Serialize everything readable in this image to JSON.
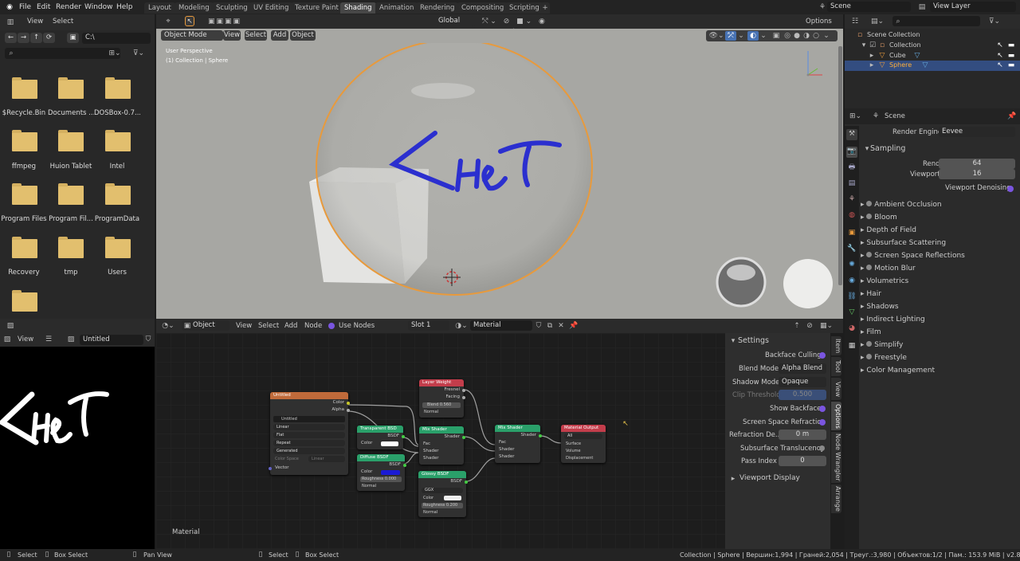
{
  "menubar": {
    "items": [
      "File",
      "Edit",
      "Render",
      "Window",
      "Help"
    ]
  },
  "workspaces": {
    "tabs": [
      "Layout",
      "Modeling",
      "Sculpting",
      "UV Editing",
      "Texture Paint",
      "Shading",
      "Animation",
      "Rendering",
      "Compositing",
      "Scripting"
    ],
    "active": "Shading",
    "add": "+"
  },
  "scene_selector": {
    "value": "Scene"
  },
  "view_layer": {
    "value": "View Layer"
  },
  "file_browser": {
    "header": {
      "view": "View",
      "select": "Select"
    },
    "path": "C:\\",
    "items": [
      "$Recycle.Bin",
      "Documents ...",
      "DOSBox-0.7...",
      "ffmpeg",
      "Huion Tablet",
      "Intel",
      "Program Files",
      "Program Fil...",
      "ProgramData",
      "Recovery",
      "tmp",
      "Users",
      ""
    ]
  },
  "image_editor": {
    "view": "View",
    "image_name": "Untitled",
    "drawing_text": "<HeT"
  },
  "viewport": {
    "header": {
      "mode": "Object Mode",
      "view": "View",
      "select": "Select",
      "add": "Add",
      "object": "Object",
      "orientation": "Global",
      "options": "Options"
    },
    "info_line1": "User Perspective",
    "info_line2": "(1) Collection | Sphere",
    "sphere_text": "<HeT"
  },
  "outliner": {
    "items": [
      {
        "label": "Scene Collection",
        "level": 0
      },
      {
        "label": "Collection",
        "level": 1
      },
      {
        "label": "Cube",
        "level": 2
      },
      {
        "label": "Sphere",
        "level": 2,
        "selected": true
      }
    ]
  },
  "properties": {
    "scene_label": "Scene",
    "render_engine_label": "Render Engine",
    "render_engine": "Eevee",
    "sampling": "Sampling",
    "render_label": "Render",
    "render_value": "64",
    "viewport_label": "Viewport",
    "viewport_value": "16",
    "denoise": "Viewport Denoising",
    "panels": [
      "Ambient Occlusion",
      "Bloom",
      "Depth of Field",
      "Subsurface Scattering",
      "Screen Space Reflections",
      "Motion Blur",
      "Volumetrics",
      "Hair",
      "Shadows",
      "Indirect Lighting",
      "Film",
      "Simplify",
      "Freestyle",
      "Color Management"
    ],
    "checkbox_panels": [
      "Ambient Occlusion",
      "Bloom",
      "Screen Space Reflections",
      "Motion Blur",
      "Simplify",
      "Freestyle"
    ]
  },
  "node_editor": {
    "header": {
      "object": "Object",
      "view": "View",
      "select": "Select",
      "add": "Add",
      "node": "Node",
      "use_nodes": "Use Nodes",
      "slot": "Slot 1",
      "material": "Material"
    },
    "footer_label": "Material",
    "nodes": {
      "image": {
        "title": "Untitled",
        "out1": "Color",
        "out2": "Alpha",
        "img": "Untitled",
        "opts": [
          "Linear",
          "Flat",
          "Repeat",
          "Generated"
        ],
        "cs_label": "Color Space",
        "cs_value": "Linear",
        "in": "Vector"
      },
      "transparent": {
        "title": "Transparent BSD",
        "out": "BSDF",
        "in": "Color"
      },
      "diffuse": {
        "title": "Diffuse BSDF",
        "out": "BSDF",
        "in1": "Color",
        "in2": "Roughness",
        "rough": "0.000",
        "in3": "Normal"
      },
      "layer_weight": {
        "title": "Layer Weight",
        "out1": "Fresnel",
        "out2": "Facing",
        "in1": "Blend",
        "blend": "0.560",
        "in2": "Normal"
      },
      "mix1": {
        "title": "Mix Shader",
        "out": "Shader",
        "in1": "Fac",
        "in2": "Shader",
        "in3": "Shader"
      },
      "glossy": {
        "title": "Glossy BSDF",
        "out": "BSDF",
        "dist": "GGX",
        "in1": "Color",
        "in2": "Roughness",
        "rough": "0.200",
        "in3": "Normal"
      },
      "mix2": {
        "title": "Mix Shader",
        "out": "Shader",
        "in1": "Fac",
        "in2": "Shader",
        "in3": "Shader"
      },
      "output": {
        "title": "Material Output",
        "target": "All",
        "in1": "Surface",
        "in2": "Volume",
        "in3": "Displacement"
      }
    }
  },
  "settings": {
    "title": "Settings",
    "backface_culling": "Backface Culling",
    "blend_label": "Blend Mode",
    "blend": "Alpha Blend",
    "shadow_label": "Shadow Mode",
    "shadow": "Opaque",
    "clip_label": "Clip Threshold",
    "clip": "0.500",
    "show_backface": "Show Backface",
    "ssr": "Screen Space Refraction",
    "refr_label": "Refraction De...",
    "refr": "0 m",
    "sss": "Subsurface Translucency",
    "pass_label": "Pass Index",
    "pass": "0",
    "viewport_display": "Viewport Display",
    "tabs": [
      "Item",
      "Tool",
      "View",
      "Options",
      "Node Wrangler",
      "Arrange"
    ]
  },
  "statusbar": {
    "s1": "Select",
    "s2": "Box Select",
    "s3": "Pan View",
    "s4": "Select",
    "s5": "Box Select",
    "info": "Collection | Sphere | Вершин:1,994 | Граней:2,054 | Треуг.:3,980 | Объектов:1/2 | Пам.: 153.9 MiB | v2.81.16"
  },
  "colors": {
    "accent": "#4772b3",
    "selected_orange": "#e89a3c",
    "folder": "#e2bf6e",
    "stroke_blue": "#2b2fcf"
  }
}
